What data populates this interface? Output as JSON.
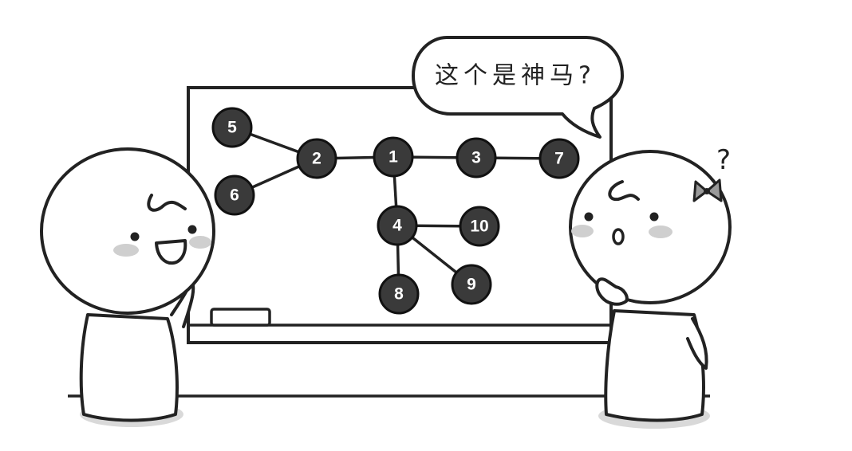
{
  "speech_bubble": {
    "text": "这个是神马?"
  },
  "question_mark": "?",
  "tree": {
    "nodes": [
      {
        "id": "1",
        "label": "1"
      },
      {
        "id": "2",
        "label": "2"
      },
      {
        "id": "3",
        "label": "3"
      },
      {
        "id": "4",
        "label": "4"
      },
      {
        "id": "5",
        "label": "5"
      },
      {
        "id": "6",
        "label": "6"
      },
      {
        "id": "7",
        "label": "7"
      },
      {
        "id": "8",
        "label": "8"
      },
      {
        "id": "9",
        "label": "9"
      },
      {
        "id": "10",
        "label": "10"
      }
    ],
    "edges": [
      [
        "1",
        "2"
      ],
      [
        "1",
        "3"
      ],
      [
        "1",
        "4"
      ],
      [
        "2",
        "5"
      ],
      [
        "2",
        "6"
      ],
      [
        "3",
        "7"
      ],
      [
        "4",
        "8"
      ],
      [
        "4",
        "9"
      ],
      [
        "4",
        "10"
      ]
    ]
  },
  "colors": {
    "node_fill": "#3a3a3a",
    "outline": "#222222",
    "blush": "#cfcfcf"
  }
}
